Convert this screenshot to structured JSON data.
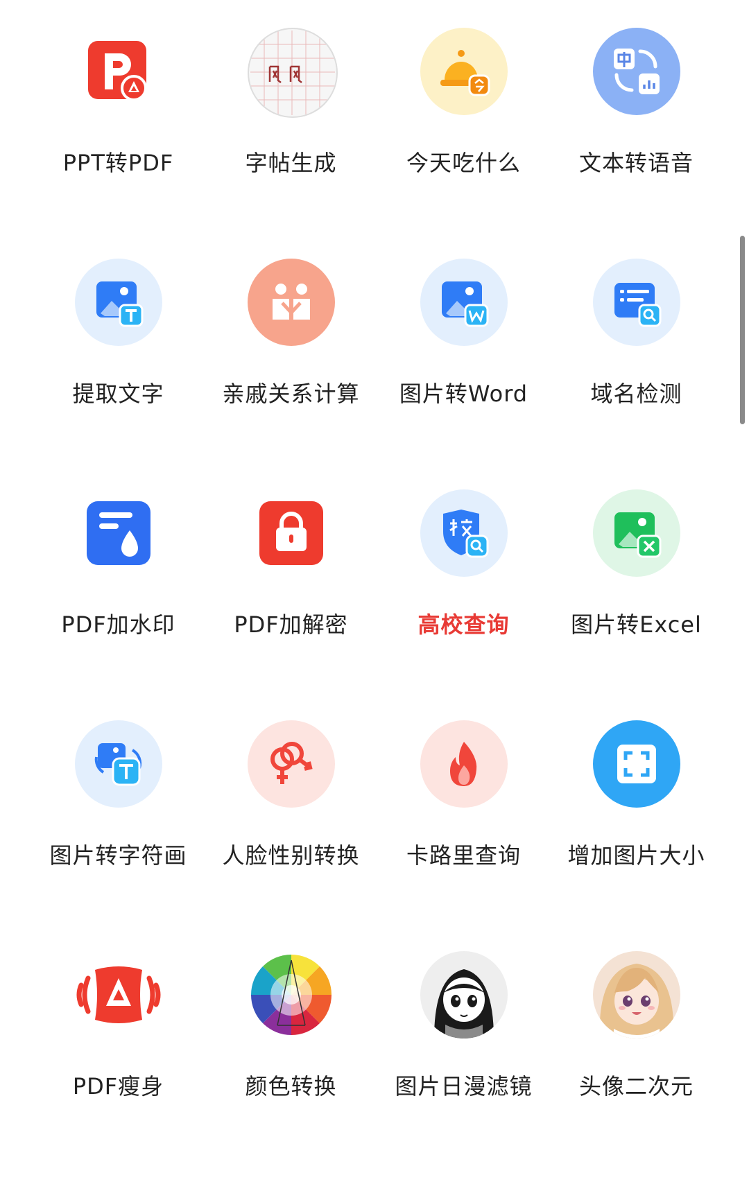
{
  "tools": [
    {
      "label": "PPT转PDF",
      "icon": "ppt-to-pdf-icon",
      "bg": "#ffffff"
    },
    {
      "label": "字帖生成",
      "icon": "calligraphy-sheet-icon",
      "bg": "#f3f3f3"
    },
    {
      "label": "今天吃什么",
      "icon": "dinner-bell-icon",
      "bg": "#fdf1c7"
    },
    {
      "label": "文本转语音",
      "icon": "text-to-speech-icon",
      "bg": "#8bb1f5"
    },
    {
      "label": "提取文字",
      "icon": "extract-text-icon",
      "bg": "#e3effd"
    },
    {
      "label": "亲戚关系计算",
      "icon": "relatives-icon",
      "bg": "#f7a48c"
    },
    {
      "label": "图片转Word",
      "icon": "image-to-word-icon",
      "bg": "#e3effd"
    },
    {
      "label": "域名检测",
      "icon": "domain-check-icon",
      "bg": "#e3effd"
    },
    {
      "label": "PDF加水印",
      "icon": "pdf-watermark-icon",
      "bg": "#ffffff"
    },
    {
      "label": "PDF加解密",
      "icon": "pdf-lock-icon",
      "bg": "#ffffff"
    },
    {
      "label": "高校查询",
      "icon": "college-search-icon",
      "bg": "#e3effd",
      "highlight": true
    },
    {
      "label": "图片转Excel",
      "icon": "image-to-excel-icon",
      "bg": "#dff6e6"
    },
    {
      "label": "图片转字符画",
      "icon": "image-to-ascii-icon",
      "bg": "#e3effd"
    },
    {
      "label": "人脸性别转换",
      "icon": "gender-swap-icon",
      "bg": "#fde4e0"
    },
    {
      "label": "卡路里查询",
      "icon": "calorie-flame-icon",
      "bg": "#fde4e0"
    },
    {
      "label": "增加图片大小",
      "icon": "resize-image-icon",
      "bg": "#2fa6f5"
    },
    {
      "label": "PDF瘦身",
      "icon": "pdf-compress-icon",
      "bg": "#ffffff"
    },
    {
      "label": "颜色转换",
      "icon": "color-wheel-icon",
      "bg": "#ffffff"
    },
    {
      "label": "图片日漫滤镜",
      "icon": "manga-filter-icon",
      "bg": "#eeeeee"
    },
    {
      "label": "头像二次元",
      "icon": "anime-avatar-icon",
      "bg": "#f4e2d4"
    }
  ],
  "colors": {
    "highlight": "#e83a35",
    "text": "#222222",
    "accent_red": "#ee3b2e",
    "accent_blue": "#2f7cf6"
  }
}
